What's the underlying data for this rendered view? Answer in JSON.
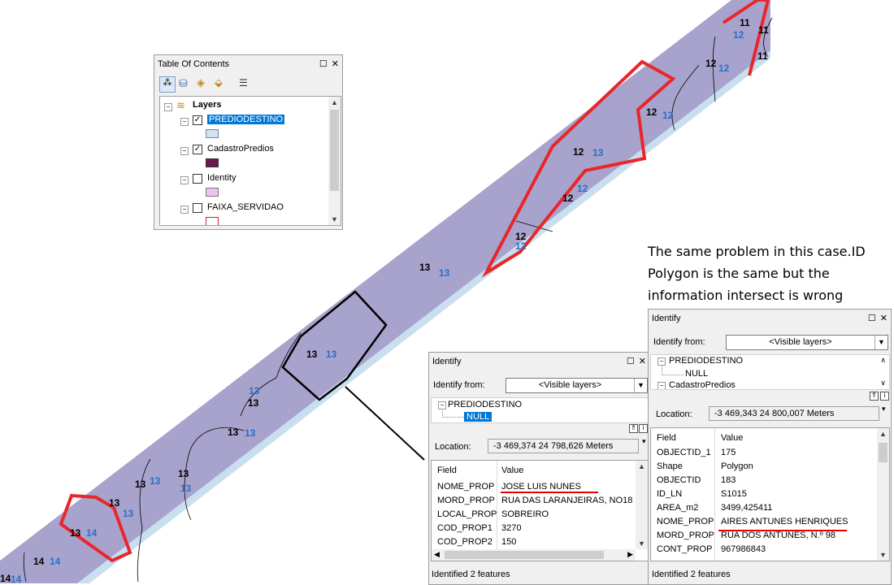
{
  "map": {
    "annotation": "The same  problem in this case.ID Polygon is the same but the information intersect is wrong",
    "labels": [
      {
        "t": "11",
        "c": "black"
      },
      {
        "t": "11",
        "c": "black"
      },
      {
        "t": "12",
        "c": "blue"
      },
      {
        "t": "11",
        "c": "black"
      },
      {
        "t": "12",
        "c": "black"
      },
      {
        "t": "12",
        "c": "blue"
      },
      {
        "t": "12",
        "c": "black"
      },
      {
        "t": "12",
        "c": "blue"
      },
      {
        "t": "12",
        "c": "black"
      },
      {
        "t": "13",
        "c": "blue"
      },
      {
        "t": "12",
        "c": "black"
      },
      {
        "t": "12",
        "c": "blue"
      },
      {
        "t": "12",
        "c": "black"
      },
      {
        "t": "12",
        "c": "blue"
      },
      {
        "t": "13",
        "c": "black"
      },
      {
        "t": "13",
        "c": "blue"
      },
      {
        "t": "13",
        "c": "black"
      },
      {
        "t": "13",
        "c": "blue"
      },
      {
        "t": "13",
        "c": "blue"
      },
      {
        "t": "13",
        "c": "black"
      },
      {
        "t": "13",
        "c": "black"
      },
      {
        "t": "13",
        "c": "blue"
      },
      {
        "t": "13",
        "c": "black"
      },
      {
        "t": "13",
        "c": "blue"
      },
      {
        "t": "13",
        "c": "black"
      },
      {
        "t": "13",
        "c": "blue"
      },
      {
        "t": "13",
        "c": "black"
      },
      {
        "t": "13",
        "c": "blue"
      },
      {
        "t": "13",
        "c": "black"
      },
      {
        "t": "14",
        "c": "blue"
      },
      {
        "t": "14",
        "c": "black"
      },
      {
        "t": "14",
        "c": "blue"
      },
      {
        "t": "14",
        "c": "black"
      },
      {
        "t": "14",
        "c": "blue"
      }
    ],
    "colors": {
      "strip": "#a8a3cc",
      "edge": "#c9dff0",
      "highlight": "#e8262b",
      "outline": "#000000",
      "blue_label": "#2a6ec8"
    }
  },
  "toc": {
    "title": "Table Of Contents",
    "root": "Layers",
    "layers": [
      {
        "name": "PREDIODESTINO",
        "checked": true,
        "selected": true,
        "swatch": "#cfe3f3",
        "swatch_border": "#6d8aa8"
      },
      {
        "name": "CadastroPredios",
        "checked": true,
        "selected": false,
        "swatch": "#6a1a4a",
        "swatch_border": "#333333"
      },
      {
        "name": "Identity",
        "checked": false,
        "selected": false,
        "swatch": "#e8c8ea",
        "swatch_border": "#8a6a8a"
      },
      {
        "name": "FAIXA_SERVIDAO",
        "checked": false,
        "selected": false,
        "swatch": "#ffffff",
        "swatch_border": "#cc2222"
      }
    ]
  },
  "identify1": {
    "title": "Identify",
    "from_label": "Identify from:",
    "from_value": "<Visible layers>",
    "tree": [
      {
        "text": "PREDIODESTINO"
      },
      {
        "text": "NULL"
      }
    ],
    "location_label": "Location:",
    "location_value": "-3 469,374  24 798,626 Meters",
    "col_field": "Field",
    "col_value": "Value",
    "rows": [
      {
        "f": "NOME_PROP",
        "v": "JOSE LUIS NUNES"
      },
      {
        "f": "MORD_PROP",
        "v": "RUA DAS LARANJEIRAS, NO18"
      },
      {
        "f": "LOCAL_PROP",
        "v": "SOBREIRO"
      },
      {
        "f": "COD_PROP1",
        "v": "3270"
      },
      {
        "f": "COD_PROP2",
        "v": "150"
      }
    ],
    "status": "Identified 2 features"
  },
  "identify2": {
    "title": "Identify",
    "from_label": "Identify from:",
    "from_value": "<Visible layers>",
    "tree": [
      {
        "text": "PREDIODESTINO"
      },
      {
        "text": "NULL"
      },
      {
        "text": "CadastroPredios"
      }
    ],
    "location_label": "Location:",
    "location_value": "-3 469,343  24 800,007 Meters",
    "col_field": "Field",
    "col_value": "Value",
    "rows": [
      {
        "f": "OBJECTID_1",
        "v": "175"
      },
      {
        "f": "Shape",
        "v": "Polygon"
      },
      {
        "f": "OBJECTID",
        "v": "183"
      },
      {
        "f": "ID_LN",
        "v": "S1015"
      },
      {
        "f": "AREA_m2",
        "v": "3499,425411"
      },
      {
        "f": "NOME_PROP",
        "v": "AIRES ANTUNES HENRIQUES"
      },
      {
        "f": "MORD_PROP",
        "v": "RUA DOS ANTUNES, N.º 98"
      },
      {
        "f": "CONT_PROP",
        "v": "967986843"
      }
    ],
    "status": "Identified 2 features"
  }
}
